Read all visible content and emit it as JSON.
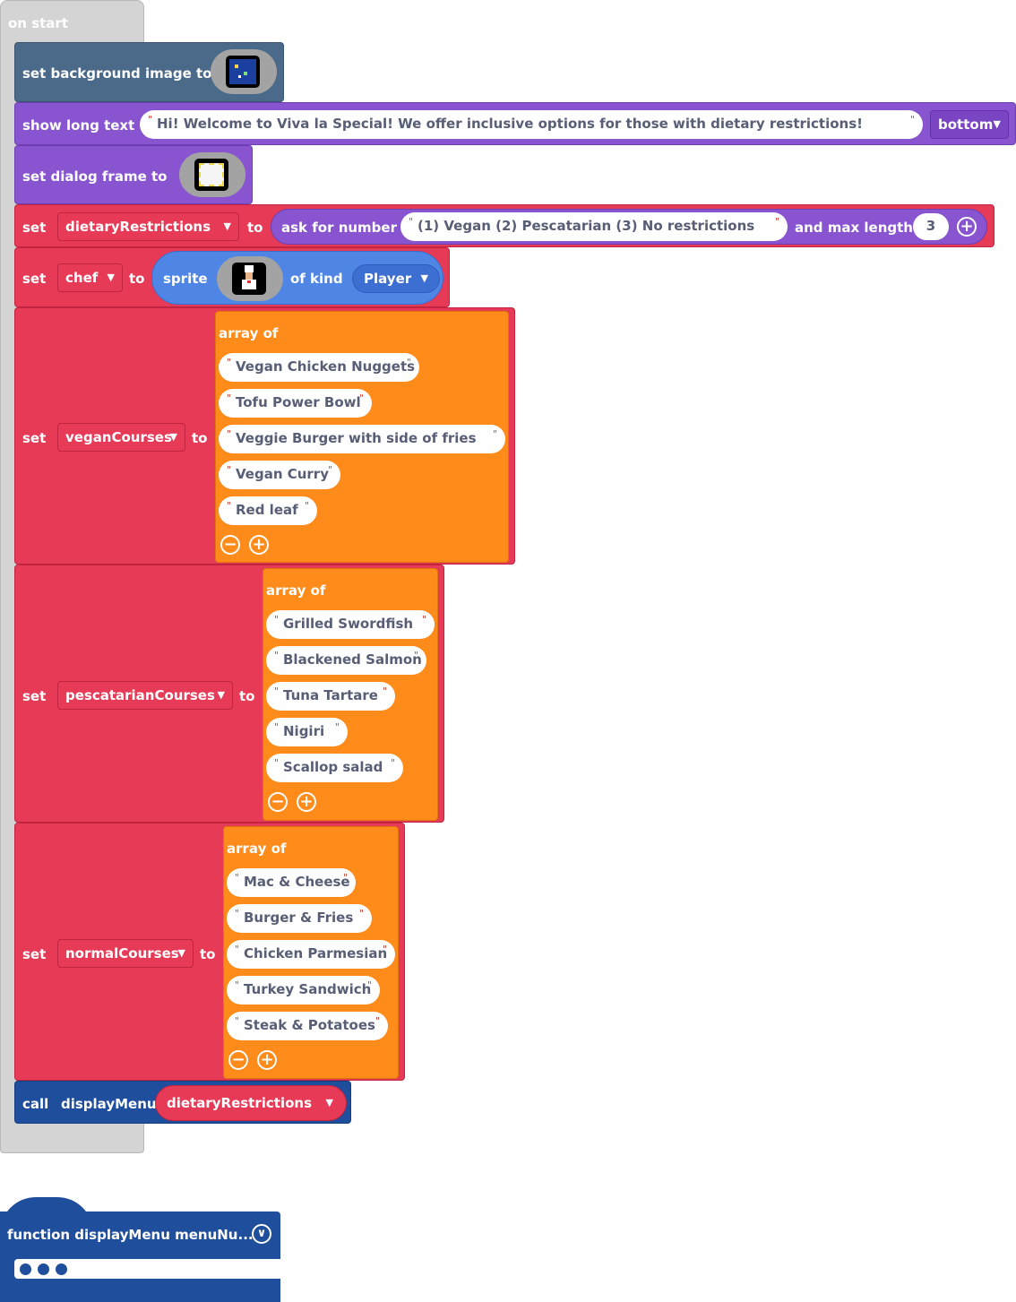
{
  "on_start": {
    "label": "on start"
  },
  "blocks": {
    "background": {
      "label": "set background image to",
      "icon": "galaxy-image-icon"
    },
    "long_text": {
      "label": "show long text",
      "text": "Hi! Welcome to Viva la Special! We offer inclusive options for those with dietary restrictions!",
      "position": "bottom"
    },
    "dialog": {
      "label": "set dialog frame to",
      "icon": "dialog-frame-icon"
    },
    "dietary": {
      "set": "set",
      "variable": "dietaryRestrictions",
      "to": "to",
      "ask": "ask for number",
      "prompt": "(1) Vegan (2) Pescatarian (3) No restrictions",
      "max_label": "and max length",
      "max": "3"
    },
    "chef": {
      "set": "set",
      "variable": "chef",
      "to": "to",
      "sprite": "sprite",
      "icon": "chef-sprite-icon",
      "of_kind": "of kind",
      "kind": "Player"
    },
    "vegan": {
      "set": "set",
      "variable": "veganCourses",
      "to": "to",
      "array_of": "array of",
      "items": [
        "Vegan Chicken Nuggets",
        "Tofu Power Bowl",
        "Veggie Burger with side of fries",
        "Vegan Curry",
        "Red leaf"
      ]
    },
    "pescatarian": {
      "set": "set",
      "variable": "pescatarianCourses",
      "to": "to",
      "array_of": "array of",
      "items": [
        "Grilled Swordfish",
        "Blackened Salmon",
        "Tuna Tartare",
        "Nigiri",
        "Scallop salad"
      ]
    },
    "normal": {
      "set": "set",
      "variable": "normalCourses",
      "to": "to",
      "array_of": "array of",
      "items": [
        "Mac & Cheese",
        "Burger & Fries",
        "Chicken Parmesian",
        "Turkey Sandwich",
        "Steak & Potatoes"
      ]
    },
    "call": {
      "call": "call",
      "fn": "displayMenu",
      "arg": "dietaryRestrictions"
    }
  },
  "function": {
    "label": "function displayMenu menuNu..."
  },
  "colors": {
    "event": "#d4d4d4",
    "scene": "#4b6a8a",
    "game": "#8854d0",
    "variables": "#e63a57",
    "sprites": "#4f86e5",
    "arrays": "#ff8b1b",
    "functions": "#1f4e9c"
  }
}
